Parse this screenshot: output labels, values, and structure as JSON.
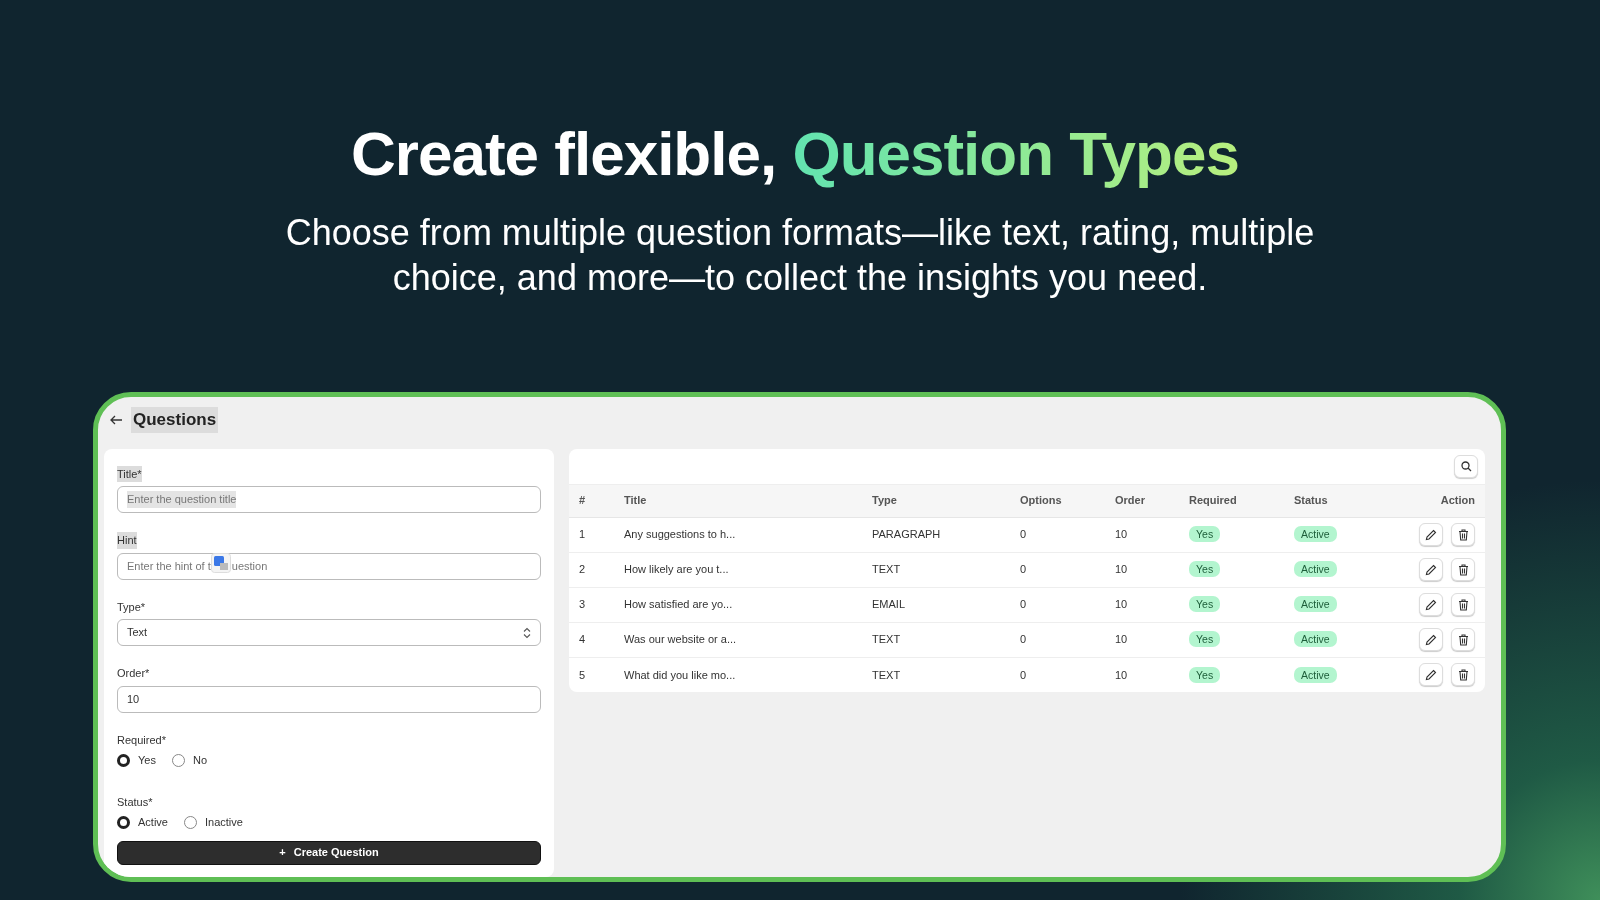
{
  "headline": {
    "plain": "Create flexible, ",
    "accent": "Question Types"
  },
  "subtitle": "Choose from multiple question formats—like text, rating, multiple choice, and more—to collect the insights you need.",
  "page": {
    "title": "Questions"
  },
  "form": {
    "title_field": {
      "label": "Title*",
      "placeholder": "Enter the question title"
    },
    "hint_field": {
      "label": "Hint",
      "placeholder_before": "Enter the hint of t",
      "placeholder_after": "uestion"
    },
    "type_field": {
      "label": "Type*",
      "value": "Text"
    },
    "order_field": {
      "label": "Order*",
      "value": "10"
    },
    "radio_groups": [
      {
        "label": "Required*",
        "options": [
          {
            "label": "Yes",
            "selected": true
          },
          {
            "label": "No",
            "selected": false
          }
        ]
      },
      {
        "label": "Status*",
        "options": [
          {
            "label": "Active",
            "selected": true
          },
          {
            "label": "Inactive",
            "selected": false
          }
        ]
      }
    ],
    "submit": {
      "icon": "+",
      "label": "Create Question"
    }
  },
  "table": {
    "columns": [
      "#",
      "Title",
      "Type",
      "Options",
      "Order",
      "Required",
      "Status",
      "Action"
    ],
    "rows": [
      {
        "num": "1",
        "title": "Any suggestions to h...",
        "type": "PARAGRAPH",
        "options": "0",
        "order": "10",
        "required": "Yes",
        "status": "Active"
      },
      {
        "num": "2",
        "title": "How likely are you t...",
        "type": "TEXT",
        "options": "0",
        "order": "10",
        "required": "Yes",
        "status": "Active"
      },
      {
        "num": "3",
        "title": "How satisfied are yo...",
        "type": "EMAIL",
        "options": "0",
        "order": "10",
        "required": "Yes",
        "status": "Active"
      },
      {
        "num": "4",
        "title": "Was our website or a...",
        "type": "TEXT",
        "options": "0",
        "order": "10",
        "required": "Yes",
        "status": "Active"
      },
      {
        "num": "5",
        "title": "What did you like mo...",
        "type": "TEXT",
        "options": "0",
        "order": "10",
        "required": "Yes",
        "status": "Active"
      }
    ]
  }
}
